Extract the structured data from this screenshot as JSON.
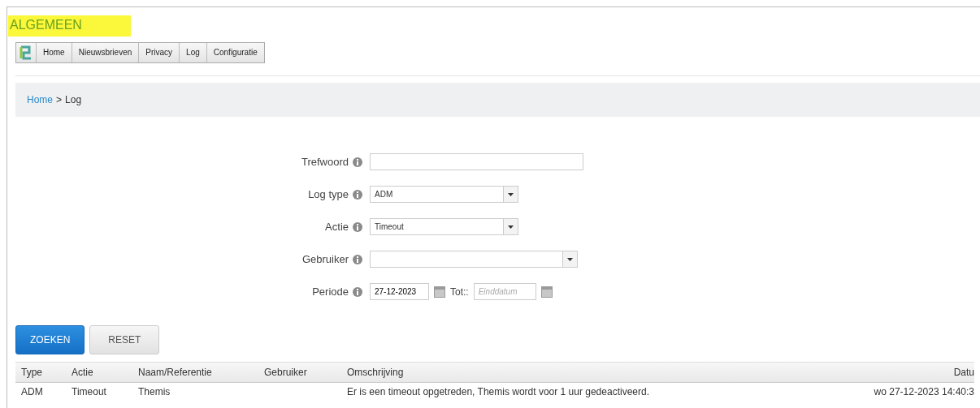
{
  "section_title": "ALGEMEEN",
  "nav": [
    "Home",
    "Nieuwsbrieven",
    "Privacy",
    "Log",
    "Configuratie"
  ],
  "breadcrumb": {
    "link": "Home",
    "separator": ">",
    "current": "Log"
  },
  "form": [
    {
      "label": "Trefwoord",
      "kind": "text"
    },
    {
      "label": "Log type",
      "kind": "select",
      "value": "ADM"
    },
    {
      "label": "Actie",
      "kind": "select",
      "value": "Timeout"
    },
    {
      "label": "Gebruiker",
      "kind": "select-wide"
    },
    {
      "label": "Periode",
      "kind": "period",
      "value": "27-12-2023",
      "between": "Tot::",
      "placeholder": "Einddatum"
    }
  ],
  "buttons": [
    {
      "label": "ZOEKEN",
      "kind": "primary"
    },
    {
      "label": "RESET",
      "kind": "secondary"
    }
  ],
  "table": {
    "columns": [
      "Type",
      "Actie",
      "Naam/Referentie",
      "Gebruiker",
      "Omschrijving",
      "Datu"
    ],
    "rows": [
      [
        "ADM",
        "Timeout",
        "Themis",
        null,
        "Er is een timeout opgetreden, Themis wordt voor 1 uur gedeactiveerd.",
        "wo 27-12-2023 14:40:3"
      ]
    ]
  }
}
